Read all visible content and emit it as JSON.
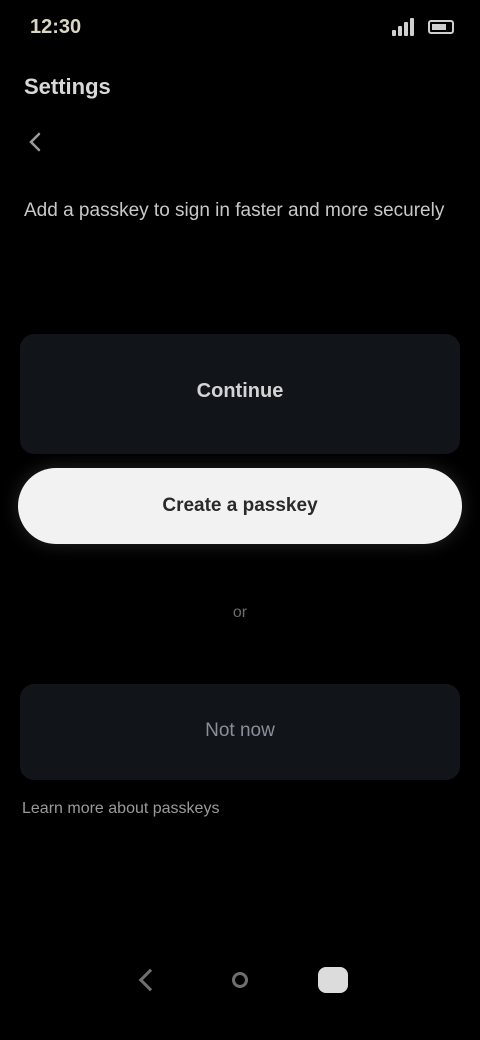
{
  "status_bar": {
    "time": "12:30"
  },
  "header": {
    "title": "Settings",
    "description": "Add a passkey to sign in faster and more securely"
  },
  "card_top": {
    "label": "Continue"
  },
  "primary_button": {
    "label": "Create a passkey"
  },
  "separator": {
    "text": "or"
  },
  "card_bottom": {
    "label": "Not now"
  },
  "footnote": {
    "text": "Learn more about passkeys"
  },
  "icons": {
    "back": "arrow-left-icon",
    "nav_back": "chevron-left-icon",
    "nav_home": "circle-icon",
    "nav_recents": "square-icon"
  },
  "colors": {
    "background": "#000000",
    "card": "#111419",
    "primary_button": "#f2f2f2"
  }
}
